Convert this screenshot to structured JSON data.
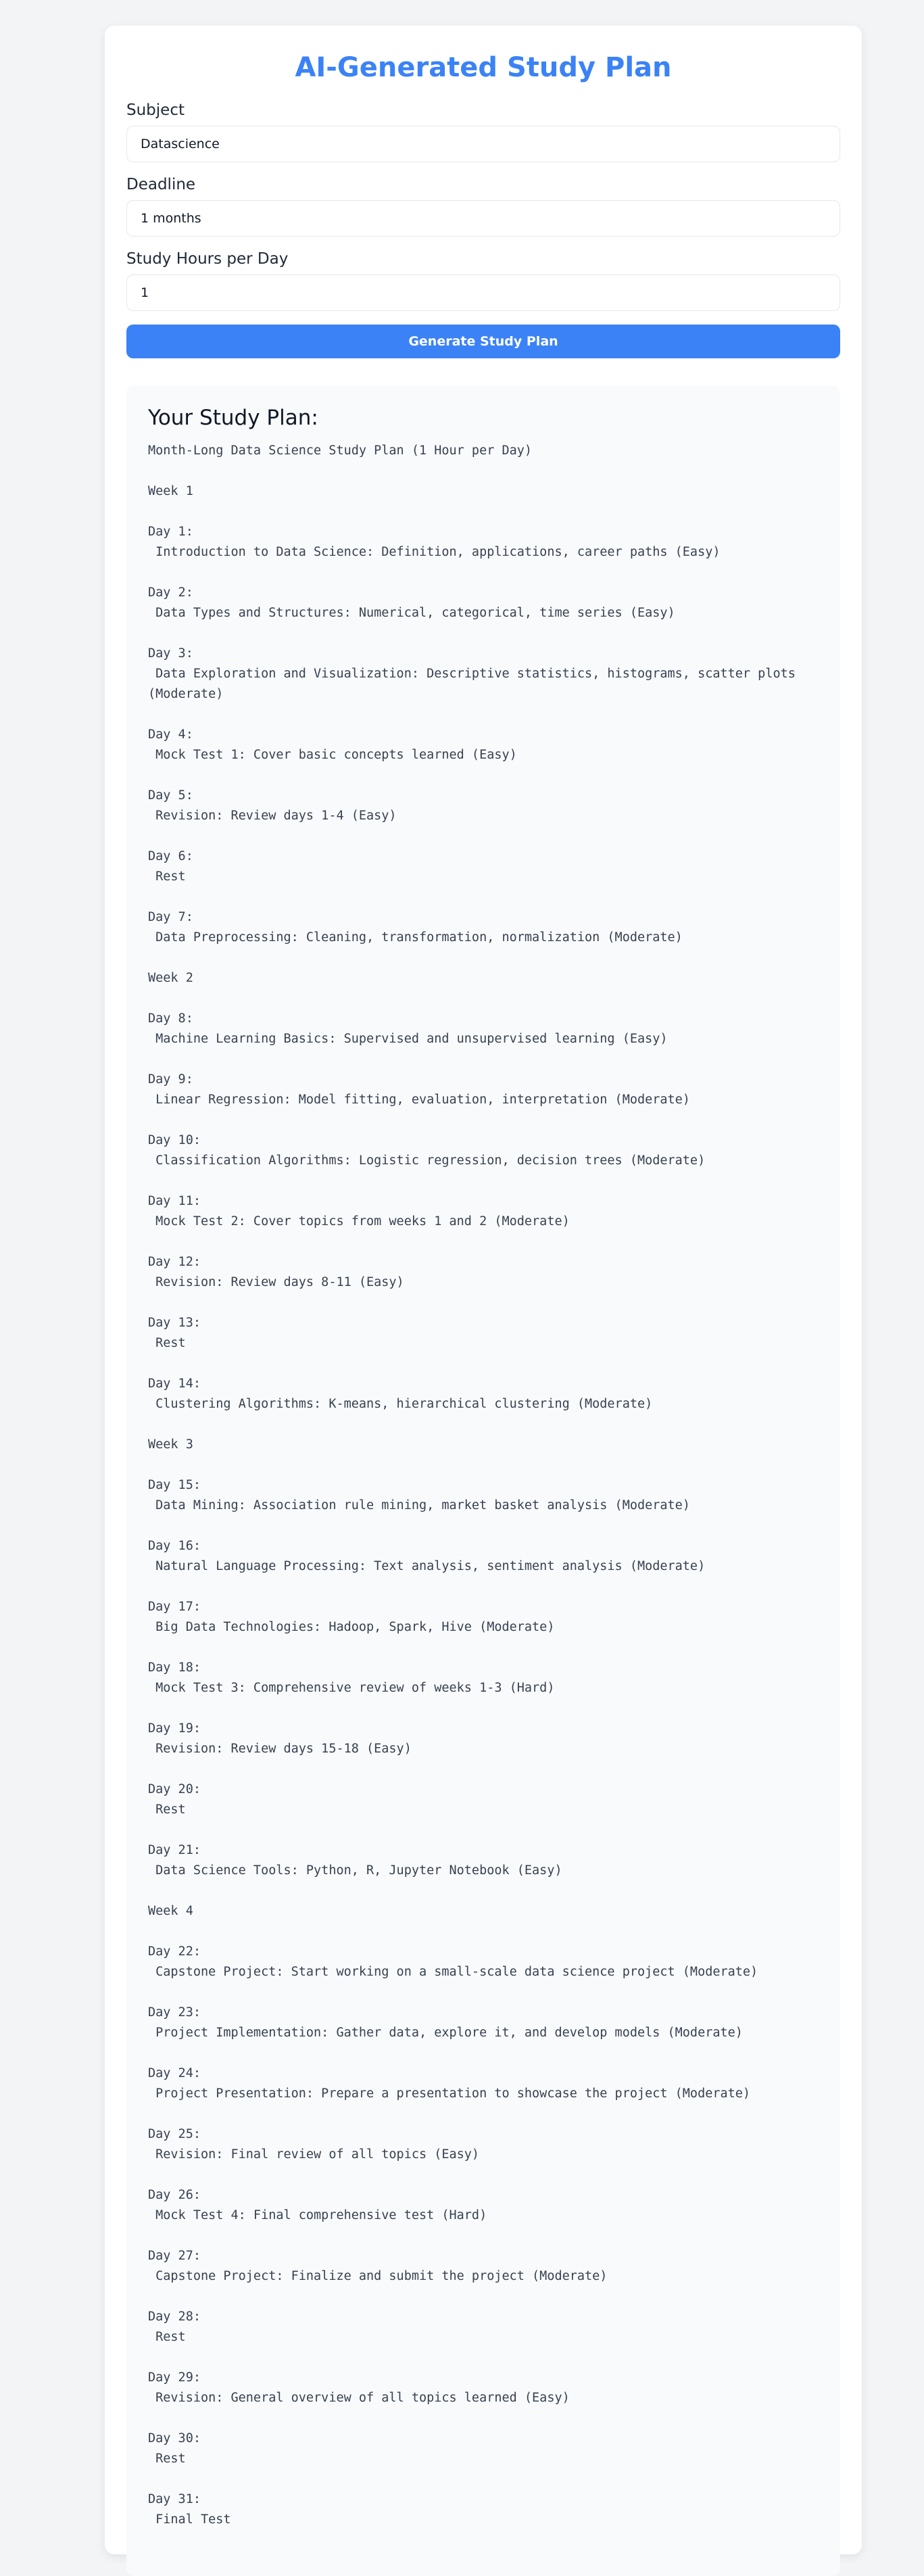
{
  "app": {
    "title": "AI-Generated Study Plan"
  },
  "form": {
    "subject": {
      "label": "Subject",
      "value": "Datascience"
    },
    "deadline": {
      "label": "Deadline",
      "value": "1 months"
    },
    "hours": {
      "label": "Study Hours per Day",
      "value": "1"
    },
    "generate_label": "Generate Study Plan"
  },
  "plan": {
    "heading": "Your Study Plan:",
    "text": "Month-Long Data Science Study Plan (1 Hour per Day)\n\nWeek 1\n\nDay 1:\n Introduction to Data Science: Definition, applications, career paths (Easy)\n\nDay 2:\n Data Types and Structures: Numerical, categorical, time series (Easy)\n\nDay 3:\n Data Exploration and Visualization: Descriptive statistics, histograms, scatter plots\n(Moderate)\n\nDay 4:\n Mock Test 1: Cover basic concepts learned (Easy)\n\nDay 5:\n Revision: Review days 1-4 (Easy)\n\nDay 6:\n Rest\n\nDay 7:\n Data Preprocessing: Cleaning, transformation, normalization (Moderate)\n\nWeek 2\n\nDay 8:\n Machine Learning Basics: Supervised and unsupervised learning (Easy)\n\nDay 9:\n Linear Regression: Model fitting, evaluation, interpretation (Moderate)\n\nDay 10:\n Classification Algorithms: Logistic regression, decision trees (Moderate)\n\nDay 11:\n Mock Test 2: Cover topics from weeks 1 and 2 (Moderate)\n\nDay 12:\n Revision: Review days 8-11 (Easy)\n\nDay 13:\n Rest\n\nDay 14:\n Clustering Algorithms: K-means, hierarchical clustering (Moderate)\n\nWeek 3\n\nDay 15:\n Data Mining: Association rule mining, market basket analysis (Moderate)\n\nDay 16:\n Natural Language Processing: Text analysis, sentiment analysis (Moderate)\n\nDay 17:\n Big Data Technologies: Hadoop, Spark, Hive (Moderate)\n\nDay 18:\n Mock Test 3: Comprehensive review of weeks 1-3 (Hard)\n\nDay 19:\n Revision: Review days 15-18 (Easy)\n\nDay 20:\n Rest\n\nDay 21:\n Data Science Tools: Python, R, Jupyter Notebook (Easy)\n\nWeek 4\n\nDay 22:\n Capstone Project: Start working on a small-scale data science project (Moderate)\n\nDay 23:\n Project Implementation: Gather data, explore it, and develop models (Moderate)\n\nDay 24:\n Project Presentation: Prepare a presentation to showcase the project (Moderate)\n\nDay 25:\n Revision: Final review of all topics (Easy)\n\nDay 26:\n Mock Test 4: Final comprehensive test (Hard)\n\nDay 27:\n Capstone Project: Finalize and submit the project (Moderate)\n\nDay 28:\n Rest\n\nDay 29:\n Revision: General overview of all topics learned (Easy)\n\nDay 30:\n Rest\n\nDay 31:\n Final Test"
  },
  "colors": {
    "accent": "#3b82f6",
    "page_bg": "#f3f4f6",
    "panel_bg": "#f9fafb"
  }
}
